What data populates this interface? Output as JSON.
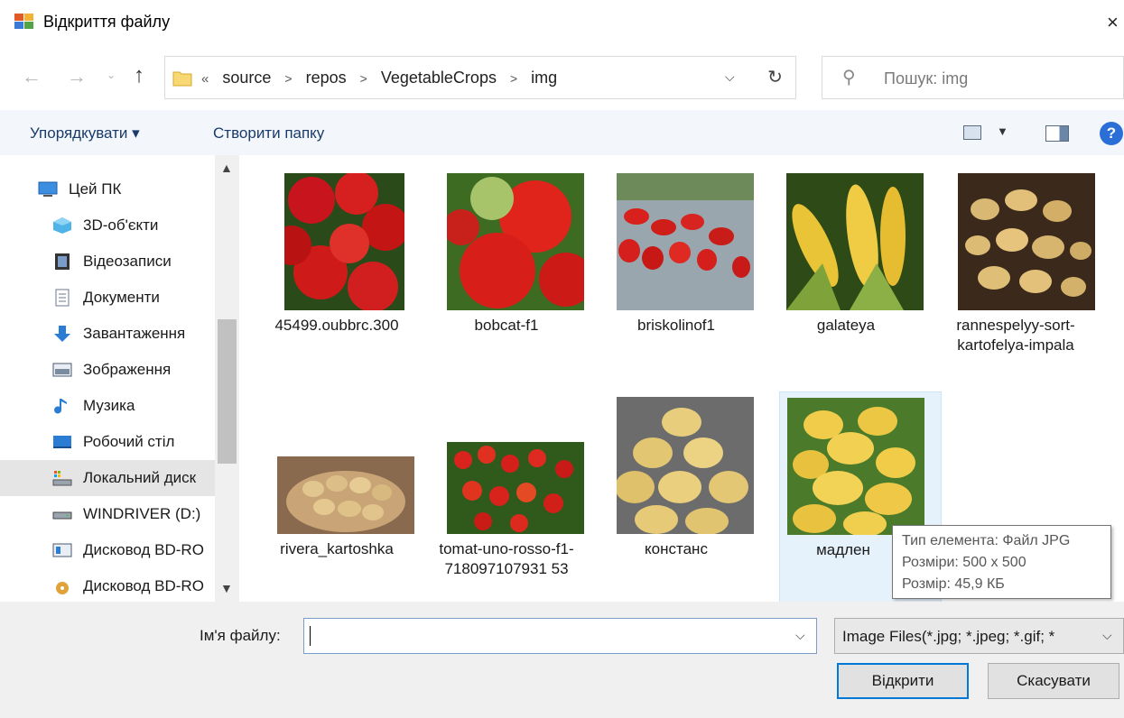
{
  "window": {
    "title": "Відкриття файлу",
    "close_glyph": "×"
  },
  "nav": {
    "back_icon": "arrow-left-icon",
    "forward_icon": "arrow-right-icon",
    "up_icon": "arrow-up-icon",
    "path_prefix": "«",
    "breadcrumbs": [
      "source",
      "repos",
      "VegetableCrops",
      "img"
    ],
    "search_placeholder": "Пошук: img"
  },
  "toolbar": {
    "organize_label": "Упорядкувати ▾",
    "new_folder_label": "Створити папку",
    "help_label": "?"
  },
  "sidebar": {
    "items": [
      {
        "label": "Цей ПК",
        "icon": "computer-icon"
      },
      {
        "label": "3D-об'єкти",
        "icon": "3d-objects-icon"
      },
      {
        "label": "Відеозаписи",
        "icon": "video-icon"
      },
      {
        "label": "Документи",
        "icon": "documents-icon"
      },
      {
        "label": "Завантаження",
        "icon": "download-icon"
      },
      {
        "label": "Зображення",
        "icon": "pictures-icon"
      },
      {
        "label": "Музика",
        "icon": "music-icon"
      },
      {
        "label": "Робочий стіл",
        "icon": "desktop-icon"
      },
      {
        "label": "Локальний диск",
        "icon": "local-disk-icon",
        "selected": true
      },
      {
        "label": "WINDRIVER (D:)",
        "icon": "drive-icon"
      },
      {
        "label": "Дисковод BD-RO",
        "icon": "bd-drive-icon"
      },
      {
        "label": "Дисковод BD-RO",
        "icon": "bd-disc-icon"
      }
    ]
  },
  "files": [
    {
      "name": "45499.oubbrc.300",
      "kind": "tomato"
    },
    {
      "name": "bobcat-f1",
      "kind": "tomato"
    },
    {
      "name": "briskolinof1",
      "kind": "cherry-tomato"
    },
    {
      "name": "galateya",
      "kind": "corn"
    },
    {
      "name": "rannespelyy-sort-kartofelya-impala",
      "kind": "potato-soil"
    },
    {
      "name": "rivera_kartoshka",
      "kind": "potato-sack"
    },
    {
      "name": "tomat-uno-rosso-f1-718097107931 53",
      "kind": "tomato-plant"
    },
    {
      "name": "констанс",
      "kind": "potato"
    },
    {
      "name": "мадлен",
      "kind": "potato"
    }
  ],
  "tooltip": {
    "line1": "Тип елемента: Файл JPG",
    "line2": "Розміри: 500 x 500",
    "line3": "Розмір: 45,9 КБ"
  },
  "footer": {
    "filename_label": "Ім'я файлу:",
    "filename_value": "",
    "filetype_value": "Image Files(*.jpg; *.jpeg; *.gif; *",
    "open_label": "Відкрити",
    "cancel_label": "Скасувати"
  },
  "colors": {
    "accent": "#0078d7",
    "toolbar_bg": "#f3f7fc",
    "footer_bg": "#f0f0f0"
  }
}
